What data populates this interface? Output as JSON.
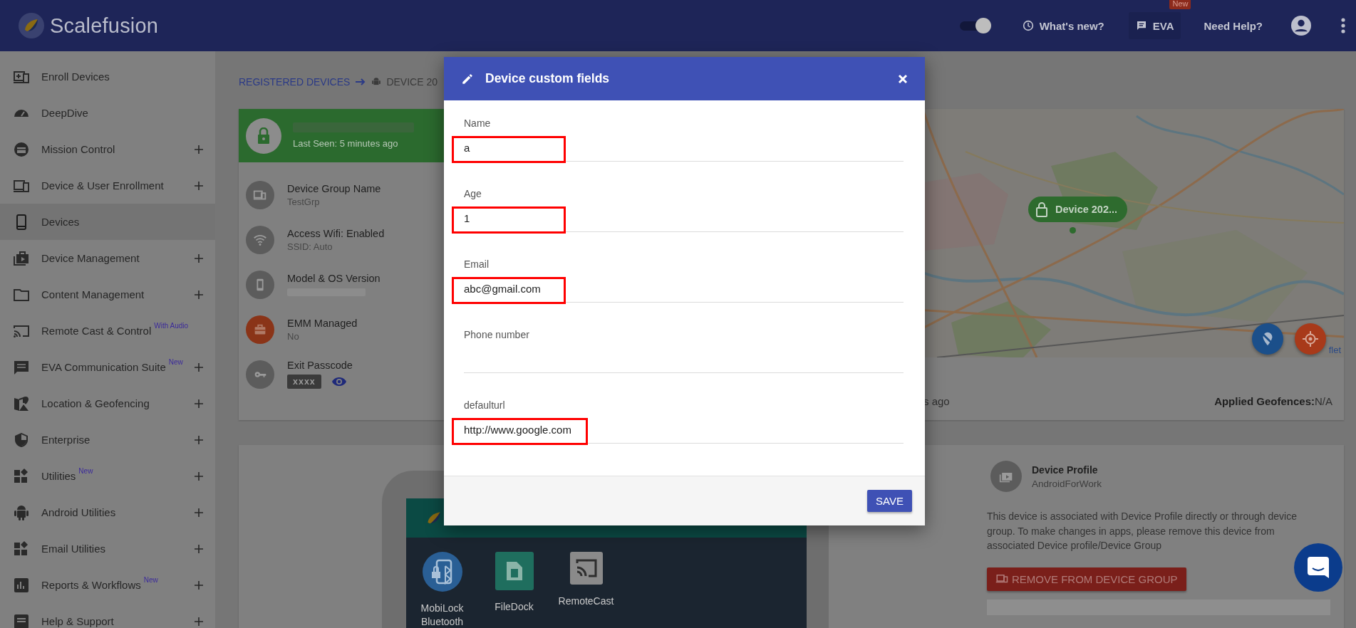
{
  "header": {
    "logo_text": "Scalefusion",
    "theme_toggle": {
      "on": true
    },
    "whats_new": "What's new?",
    "eva": {
      "label": "EVA",
      "badge": "New"
    },
    "help": "Need Help?"
  },
  "sidebar": {
    "items": [
      {
        "label": "Enroll Devices",
        "expandable": false,
        "selected": false
      },
      {
        "label": "DeepDive",
        "expandable": false,
        "selected": false
      },
      {
        "label": "Mission Control",
        "expandable": true,
        "selected": false
      },
      {
        "label": "Device & User Enrollment",
        "expandable": true,
        "selected": false
      },
      {
        "label": "Devices",
        "expandable": false,
        "selected": true
      },
      {
        "label": "Device Management",
        "expandable": true,
        "selected": false
      },
      {
        "label": "Content Management",
        "expandable": true,
        "selected": false
      },
      {
        "label": "Remote Cast & Control",
        "badge": "With Audio",
        "expandable": false,
        "selected": false
      },
      {
        "label": "EVA Communication Suite",
        "badge": "New",
        "expandable": true,
        "selected": false
      },
      {
        "label": "Location & Geofencing",
        "expandable": true,
        "selected": false
      },
      {
        "label": "Enterprise",
        "expandable": true,
        "selected": false
      },
      {
        "label": "Utilities",
        "badge": "New",
        "expandable": true,
        "selected": false
      },
      {
        "label": "Android Utilities",
        "expandable": true,
        "selected": false
      },
      {
        "label": "Email Utilities",
        "expandable": true,
        "selected": false
      },
      {
        "label": "Reports & Workflows",
        "badge": "New",
        "expandable": true,
        "selected": false
      },
      {
        "label": "Help & Support",
        "expandable": true,
        "selected": false
      }
    ]
  },
  "breadcrumb": {
    "parent": "REGISTERED DEVICES",
    "current": "DEVICE 20"
  },
  "device_card": {
    "name_redacted": true,
    "status": "Last Seen: 5 minutes ago",
    "details": [
      {
        "title": "Device Group Name",
        "value": "TestGrp",
        "kind": "text",
        "color": "#5c5c5c"
      },
      {
        "title": "Access Wifi: Enabled",
        "value": "SSID: Auto",
        "kind": "text",
        "color": "#5c5c5c"
      },
      {
        "title": "Model & OS Version",
        "kind": "redacted",
        "color": "#5c5c5c"
      },
      {
        "title": "EMM Managed",
        "value": "No",
        "kind": "text",
        "color": "#8a3418"
      },
      {
        "title": "Exit Passcode",
        "value": "xxxx",
        "kind": "passcode",
        "color": "#5c5c5c"
      }
    ],
    "map": {
      "kind": "picture",
      "marker": "Device 202...",
      "attribution": "flet"
    },
    "last_seen_tail": "s ago",
    "geofences": "**Applied Geofences:**N/A"
  },
  "phone": {
    "apps": [
      {
        "label": "MobiLock Bluetooth"
      },
      {
        "label": "FileDock"
      },
      {
        "label": "RemoteCast"
      }
    ]
  },
  "profile": {
    "title": "Device Profile",
    "value": "AndroidForWork",
    "description": "This device is associated with Device Profile directly or through device group. To make changes in apps, please remove this device from associated Device profile/Device Group",
    "remove_button": "REMOVE FROM DEVICE GROUP"
  },
  "modal": {
    "title": "Device custom fields",
    "fields": [
      {
        "label": "Name",
        "value": "a",
        "highlighted": true
      },
      {
        "label": "Age",
        "value": "1",
        "highlighted": true
      },
      {
        "label": "Email",
        "value": "abc@gmail.com",
        "highlighted": true
      },
      {
        "label": "Phone number",
        "highlighted": false
      },
      {
        "label": "defaulturl",
        "value": "http://www.google.com",
        "highlighted": true
      }
    ],
    "save": "SAVE"
  }
}
